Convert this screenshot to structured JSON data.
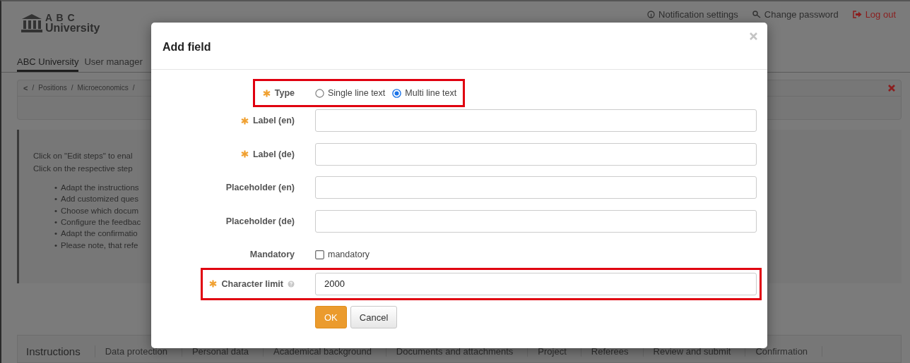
{
  "header": {
    "logo": {
      "line1": "A B C",
      "line2": "University"
    },
    "links": [
      {
        "label": "Notification settings",
        "kind": "notifications"
      },
      {
        "label": "Change password",
        "kind": "password"
      },
      {
        "label": "Log out",
        "kind": "logout"
      }
    ]
  },
  "nav_tabs": [
    {
      "label": "ABC University",
      "selected": true
    },
    {
      "label": "User manager",
      "selected": false
    }
  ],
  "breadcrumb": [
    "<",
    "/",
    "Positions",
    "/",
    "Microeconomics",
    "/"
  ],
  "info": {
    "lines": [
      "Click on \"Edit steps\" to enal",
      "Click on the respective step"
    ],
    "bullets": [
      {
        "marker": "•",
        "text": "Adapt the instructions"
      },
      {
        "marker": "•",
        "text": "Add customized ques"
      },
      {
        "marker": "•",
        "text": "Choose which docum"
      },
      {
        "marker": "•",
        "text": "Configure the feedbac"
      },
      {
        "marker": "•",
        "text": "Adapt the confirmatio"
      },
      {
        "marker": "•",
        "text": "Please note, that refe"
      }
    ]
  },
  "steps": [
    {
      "label": "Instructions",
      "selected": true
    },
    {
      "label": "Data protection",
      "selected": false
    },
    {
      "label": "Personal data",
      "selected": false
    },
    {
      "label": "Academical background",
      "selected": false
    },
    {
      "label": "Documents and attachments",
      "selected": false
    },
    {
      "label": "Project",
      "selected": false
    },
    {
      "label": "Referees",
      "selected": false
    },
    {
      "label": "Review and submit",
      "selected": false
    },
    {
      "label": "Confirmation",
      "selected": false
    }
  ],
  "dialog": {
    "title": "Add field",
    "fields": [
      {
        "kind": "radio",
        "label": "Type",
        "required": true,
        "highlighted": true,
        "options": [
          {
            "label": "Single line text",
            "selected": false
          },
          {
            "label": "Multi line text",
            "selected": true
          }
        ]
      },
      {
        "kind": "input",
        "label": "Label (en)",
        "required": true,
        "highlighted": false
      },
      {
        "kind": "input",
        "label": "Label (de)",
        "required": true,
        "highlighted": false
      },
      {
        "kind": "input",
        "label": "Placeholder (en)",
        "required": false,
        "highlighted": false
      },
      {
        "kind": "input",
        "label": "Placeholder (de)",
        "required": false,
        "highlighted": false
      },
      {
        "kind": "checkbox",
        "label": "Mandatory",
        "required": false,
        "highlighted": false,
        "option": "mandatory",
        "checked": false
      },
      {
        "kind": "input",
        "label": "Character limit",
        "required": true,
        "help": true,
        "value": "2000",
        "highlighted": true
      }
    ],
    "buttons": [
      {
        "label": "OK",
        "kind": "primary"
      },
      {
        "label": "Cancel",
        "kind": "default"
      }
    ]
  }
}
